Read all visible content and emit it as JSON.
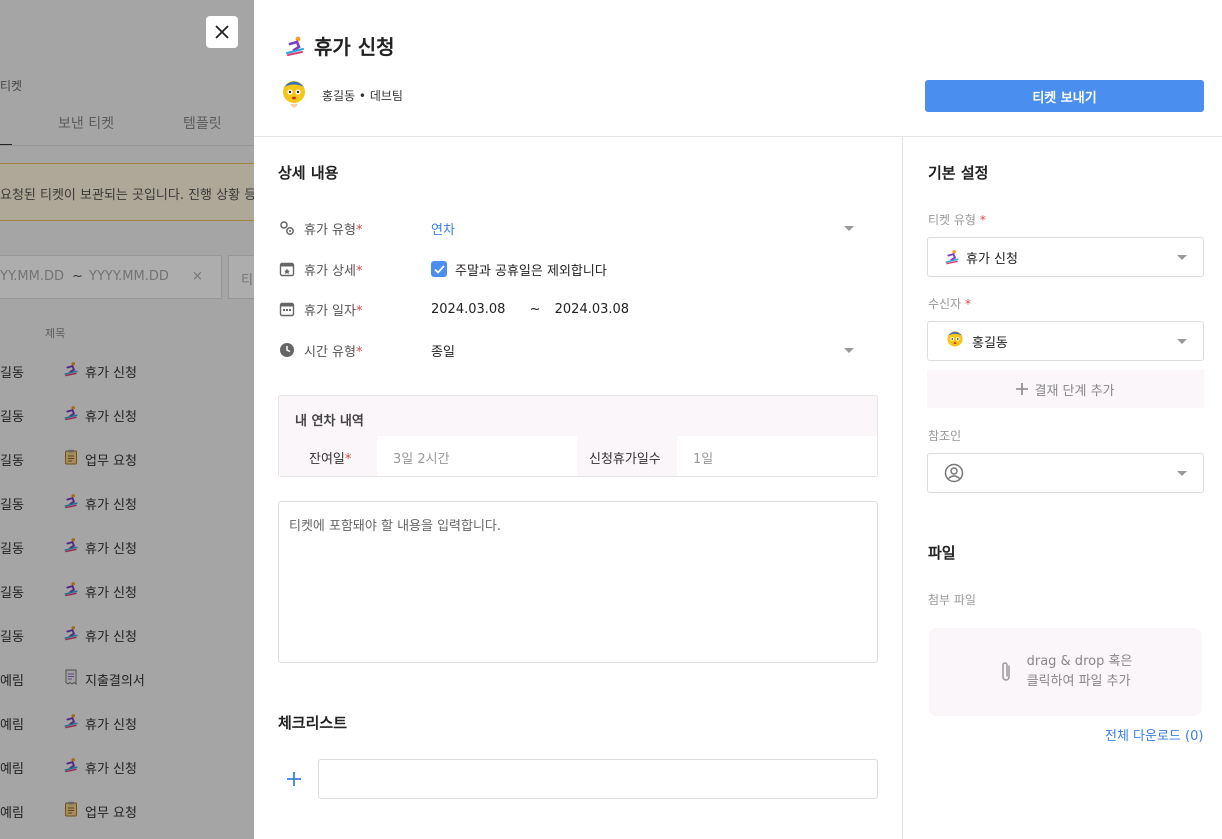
{
  "background": {
    "page_title": "티켓",
    "tabs": [
      "보낸 티켓",
      "템플릿"
    ],
    "notice": "요청된 티켓이 보관되는 곳입니다. 진행 상황 등을",
    "date_from_placeholder": "YY.MM.DD",
    "date_sep": "~",
    "date_to_placeholder": "YYYY.MM.DD",
    "date_clear": "×",
    "filter_prefix": "티",
    "column_title": "제목",
    "rows": [
      {
        "author": "길동",
        "title": "휴가 신청",
        "icon": "skier-icon"
      },
      {
        "author": "길동",
        "title": "휴가 신청",
        "icon": "skier-icon"
      },
      {
        "author": "길동",
        "title": "업무 요청",
        "icon": "clipboard-icon"
      },
      {
        "author": "길동",
        "title": "휴가 신청",
        "icon": "skier-icon"
      },
      {
        "author": "길동",
        "title": "휴가 신청",
        "icon": "skier-icon"
      },
      {
        "author": "길동",
        "title": "휴가 신청",
        "icon": "skier-icon"
      },
      {
        "author": "길동",
        "title": "휴가 신청",
        "icon": "skier-icon"
      },
      {
        "author": "예림",
        "title": "지출결의서",
        "icon": "receipt-icon"
      },
      {
        "author": "예림",
        "title": "휴가 신청",
        "icon": "skier-icon"
      },
      {
        "author": "예림",
        "title": "휴가 신청",
        "icon": "skier-icon"
      },
      {
        "author": "예림",
        "title": "업무 요청",
        "icon": "clipboard-icon"
      }
    ]
  },
  "drawer": {
    "title": "휴가 신청",
    "user_line": "홍길동 • 데브팀",
    "send_button": "티켓 보내기",
    "details": {
      "heading": "상세 내용",
      "fields": [
        {
          "label": "휴가 유형",
          "value": "연차",
          "icon": "settings-icon"
        },
        {
          "label": "휴가 상세",
          "value": "주말과 공휴일은 제외합니다",
          "icon": "calendar-star-icon"
        },
        {
          "label": "휴가 일자",
          "value_from": "2024.03.08",
          "sep": "~",
          "value_to": "2024.03.08",
          "icon": "calendar-icon"
        },
        {
          "label": "시간 유형",
          "value": "종일",
          "icon": "clock-icon"
        }
      ],
      "required_mark": "*"
    },
    "leave_history": {
      "heading": "내 연차 내역",
      "remaining_label": "잔여일",
      "remaining_value": "3일 2시간",
      "requested_label": "신청휴가일수",
      "requested_value": "1일"
    },
    "content_placeholder": "티켓에 포함돼야 할 내용을 입력합니다.",
    "checklist": {
      "heading": "체크리스트"
    },
    "settings": {
      "heading": "기본 설정",
      "ticket_type_label": "티켓 유형",
      "ticket_type_value": "휴가 신청",
      "recipient_label": "수신자",
      "recipient_value": "홍길동",
      "add_step": "결재 단계 추가",
      "cc_label": "참조인"
    },
    "files": {
      "heading": "파일",
      "attach_label": "첨부 파일",
      "drop_line1": "drag & drop 혹은",
      "drop_line2": "클릭하여 파일 추가",
      "download_all": "전체 다운로드 (0)"
    }
  },
  "colors": {
    "accent": "#4a8ff0",
    "link": "#3b7fe0",
    "required": "#e04848"
  }
}
